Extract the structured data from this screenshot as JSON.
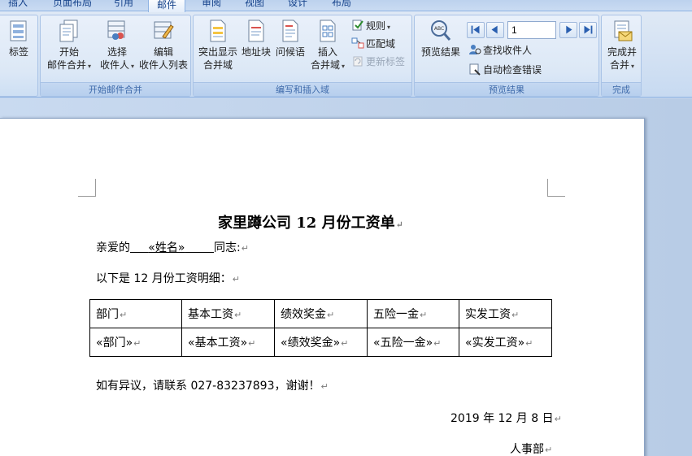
{
  "tabs": [
    {
      "label": "插入",
      "active": false
    },
    {
      "label": "页面布局",
      "active": false
    },
    {
      "label": "引用",
      "active": false
    },
    {
      "label": "邮件",
      "active": true
    },
    {
      "label": "审阅",
      "active": false
    },
    {
      "label": "视图",
      "active": false
    },
    {
      "label": "设计",
      "active": false
    },
    {
      "label": "布局",
      "active": false
    }
  ],
  "ribbon": {
    "groups": {
      "create": {
        "button": "标签"
      },
      "start_merge": {
        "label": "开始邮件合并",
        "start": {
          "line1": "开始",
          "line2": "邮件合并"
        },
        "select": {
          "line1": "选择",
          "line2": "收件人"
        },
        "edit": {
          "line1": "编辑",
          "line2": "收件人列表"
        }
      },
      "write_insert": {
        "label": "编写和插入域",
        "highlight": {
          "line1": "突出显示",
          "line2": "合并域"
        },
        "address": "地址块",
        "greeting": "问候语",
        "insert": {
          "line1": "插入",
          "line2": "合并域"
        },
        "rules": "规则",
        "match": "匹配域",
        "update": "更新标签"
      },
      "preview": {
        "label": "预览结果",
        "button": "预览结果",
        "record": "1",
        "find": "查找收件人",
        "check": "自动检查错误"
      },
      "finish": {
        "label": "完成",
        "button": {
          "line1": "完成并",
          "line2": "合并"
        }
      }
    }
  },
  "document": {
    "title": "家里蹲公司 12 月份工资单",
    "greeting_prefix": "亲爱的",
    "name_field": "«姓名»",
    "greeting_suffix": "同志:",
    "intro": "以下是 12 月份工资明细：",
    "table": {
      "headers": [
        "部门",
        "基本工资",
        "绩效奖金",
        "五险一金",
        "实发工资"
      ],
      "fields": [
        "«部门»",
        "«基本工资»",
        "«绩效奖金»",
        "«五险一金»",
        "«实发工资»"
      ]
    },
    "contact": "如有异议，请联系 027-83237893，谢谢！",
    "date": "2019 年 12 月 8 日",
    "dept": "人事部"
  }
}
